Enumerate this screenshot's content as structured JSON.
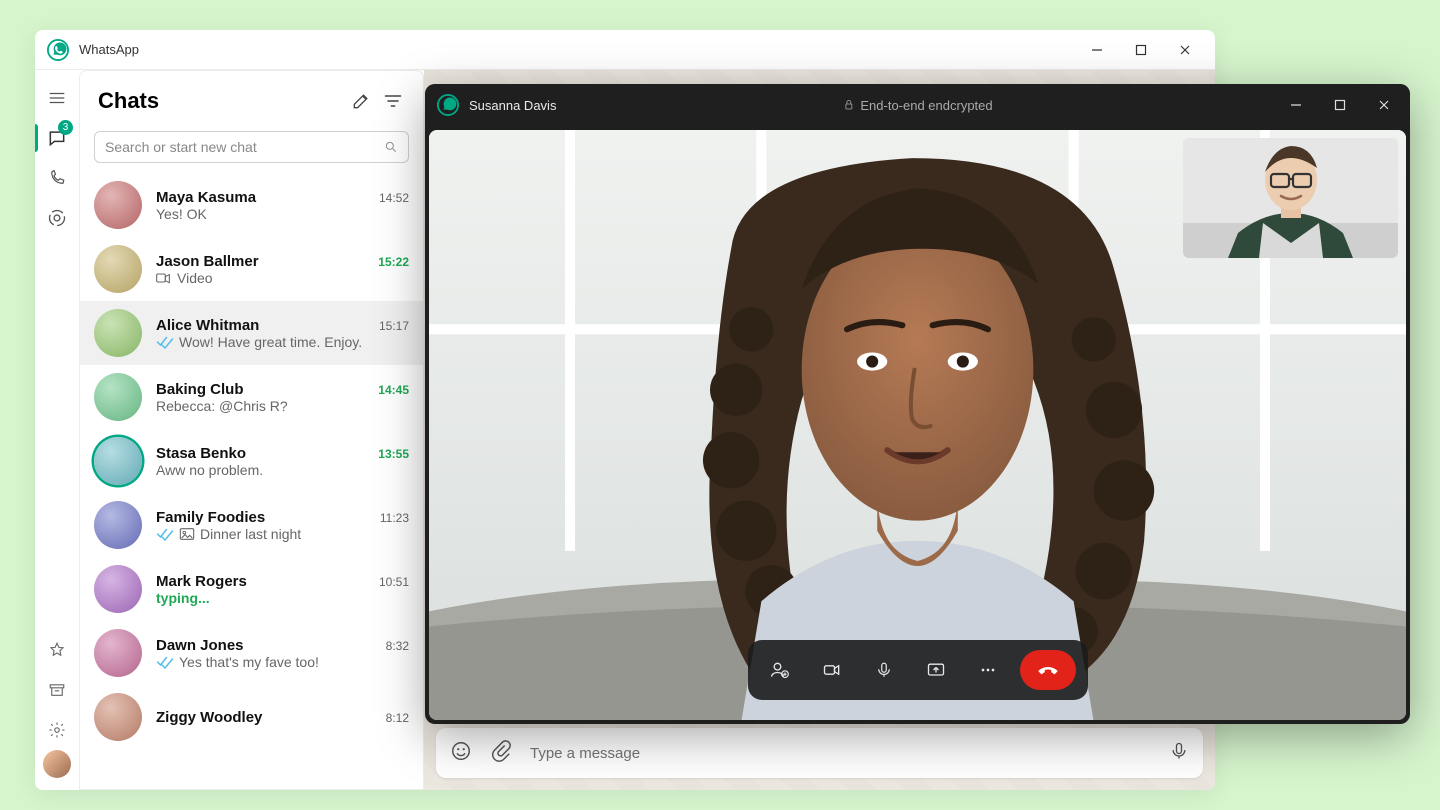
{
  "app": {
    "name": "WhatsApp",
    "chats_title": "Chats",
    "search_placeholder": "Search or start new chat",
    "compose_placeholder": "Type a message"
  },
  "nav": {
    "chats_badge": "3"
  },
  "chats": [
    {
      "name": "Maya Kasuma",
      "time": "14:52",
      "preview": "Yes! OK",
      "time_green": false
    },
    {
      "name": "Jason Ballmer",
      "time": "15:22",
      "preview": "Video",
      "time_green": true,
      "video_icon": true
    },
    {
      "name": "Alice Whitman",
      "time": "15:17",
      "preview": "Wow! Have great time. Enjoy.",
      "ticks": true,
      "selected": true
    },
    {
      "name": "Baking Club",
      "time": "14:45",
      "preview": "Rebecca: @Chris R?",
      "time_green": true,
      "mention": true
    },
    {
      "name": "Stasa Benko",
      "time": "13:55",
      "preview": "Aww no problem.",
      "time_green": true,
      "ring": true
    },
    {
      "name": "Family Foodies",
      "time": "11:23",
      "preview": "Dinner last night",
      "ticks": true,
      "photo_icon": true
    },
    {
      "name": "Mark Rogers",
      "time": "10:51",
      "preview": "typing...",
      "typing": true
    },
    {
      "name": "Dawn Jones",
      "time": "8:32",
      "preview": "Yes that's my fave too!",
      "ticks": true
    },
    {
      "name": "Ziggy Woodley",
      "time": "8:12",
      "preview": ""
    }
  ],
  "call": {
    "remote_name": "Susanna Davis",
    "encryption_label": "End-to-end endcrypted"
  }
}
